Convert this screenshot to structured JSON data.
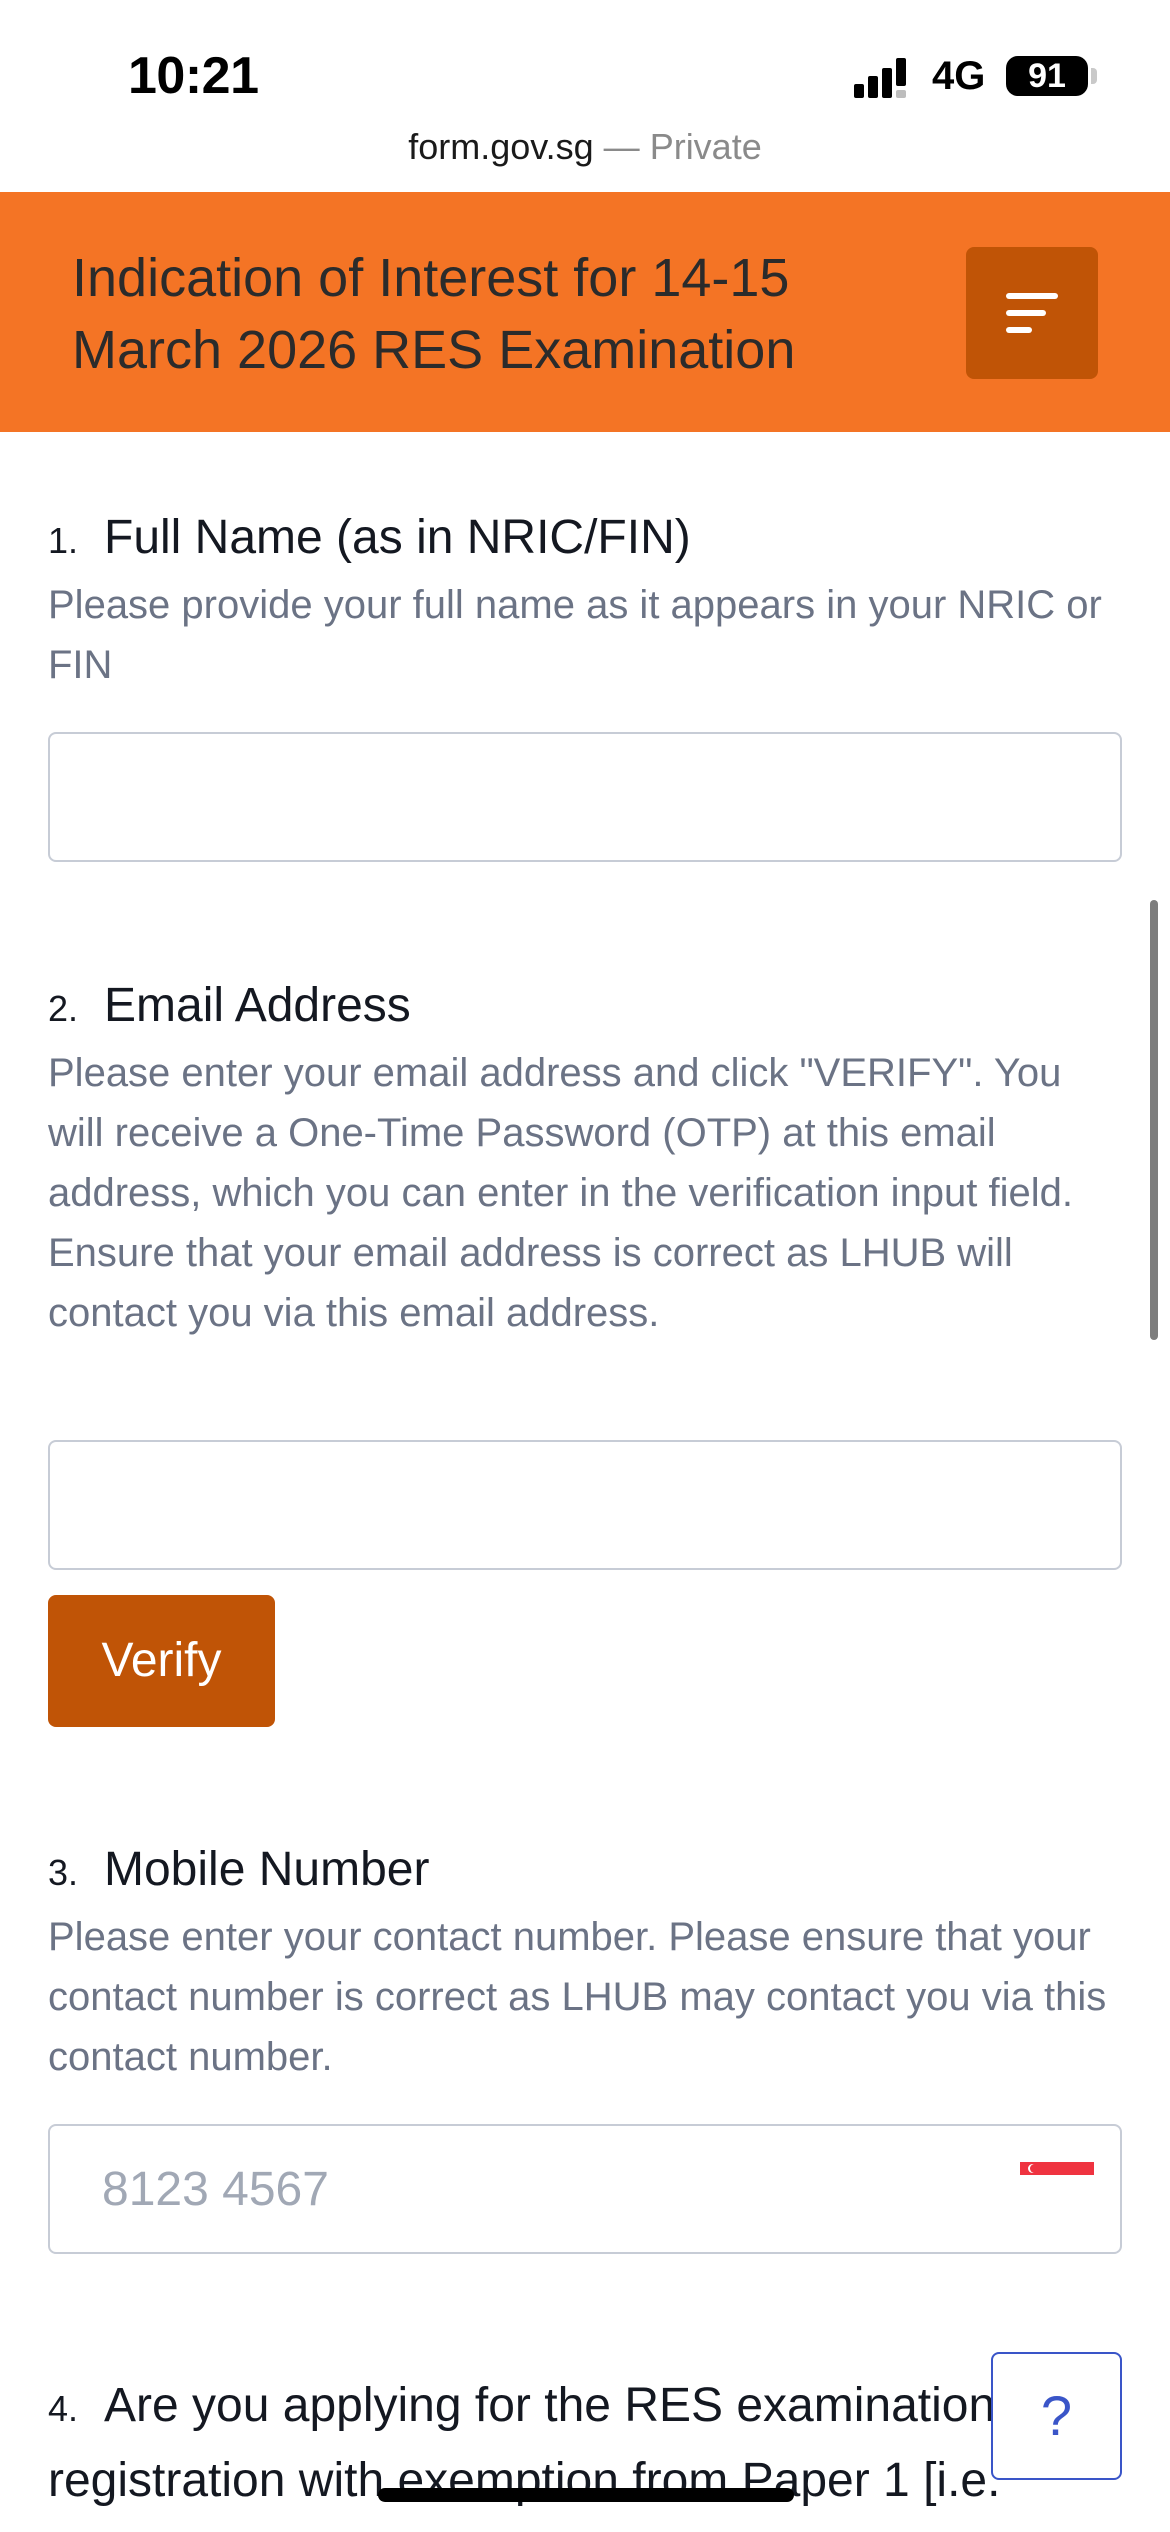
{
  "status_bar": {
    "time": "10:21",
    "network": "4G",
    "battery": "91"
  },
  "browser": {
    "host": "form.gov.sg",
    "separator": " — ",
    "privacy": "Private"
  },
  "header": {
    "title": "Indication of Interest for 14-15 March 2026 RES Examination",
    "menu_icon": "menu-lines-icon",
    "color": "#f47425"
  },
  "questions": [
    {
      "number": "1.",
      "title": "Full Name (as in NRIC/FIN)",
      "description": "Please provide your full name as it appears in your NRIC or FIN",
      "value": ""
    },
    {
      "number": "2.",
      "title": "Email Address",
      "description": "Please enter your email address and click \"VERIFY\". You will receive a One-Time Password (OTP) at this email address, which you can enter in the verification input field. Ensure that your email address is correct as LHUB will contact you via this email address.",
      "value": "",
      "button_label": "Verify"
    },
    {
      "number": "3.",
      "title": "Mobile Number",
      "description": "Please enter your contact number. Please ensure that your contact number is correct as LHUB may contact you via this contact number.",
      "placeholder": "8123 4567",
      "country_icon": "singapore-flag-icon"
    },
    {
      "number": "4.",
      "title": "Are you applying for the RES examination registration with exemption from Paper 1 [i.e."
    }
  ],
  "help_button": "?",
  "colors": {
    "accent": "#f47425",
    "button": "#c05406",
    "help": "#3a55c8"
  }
}
